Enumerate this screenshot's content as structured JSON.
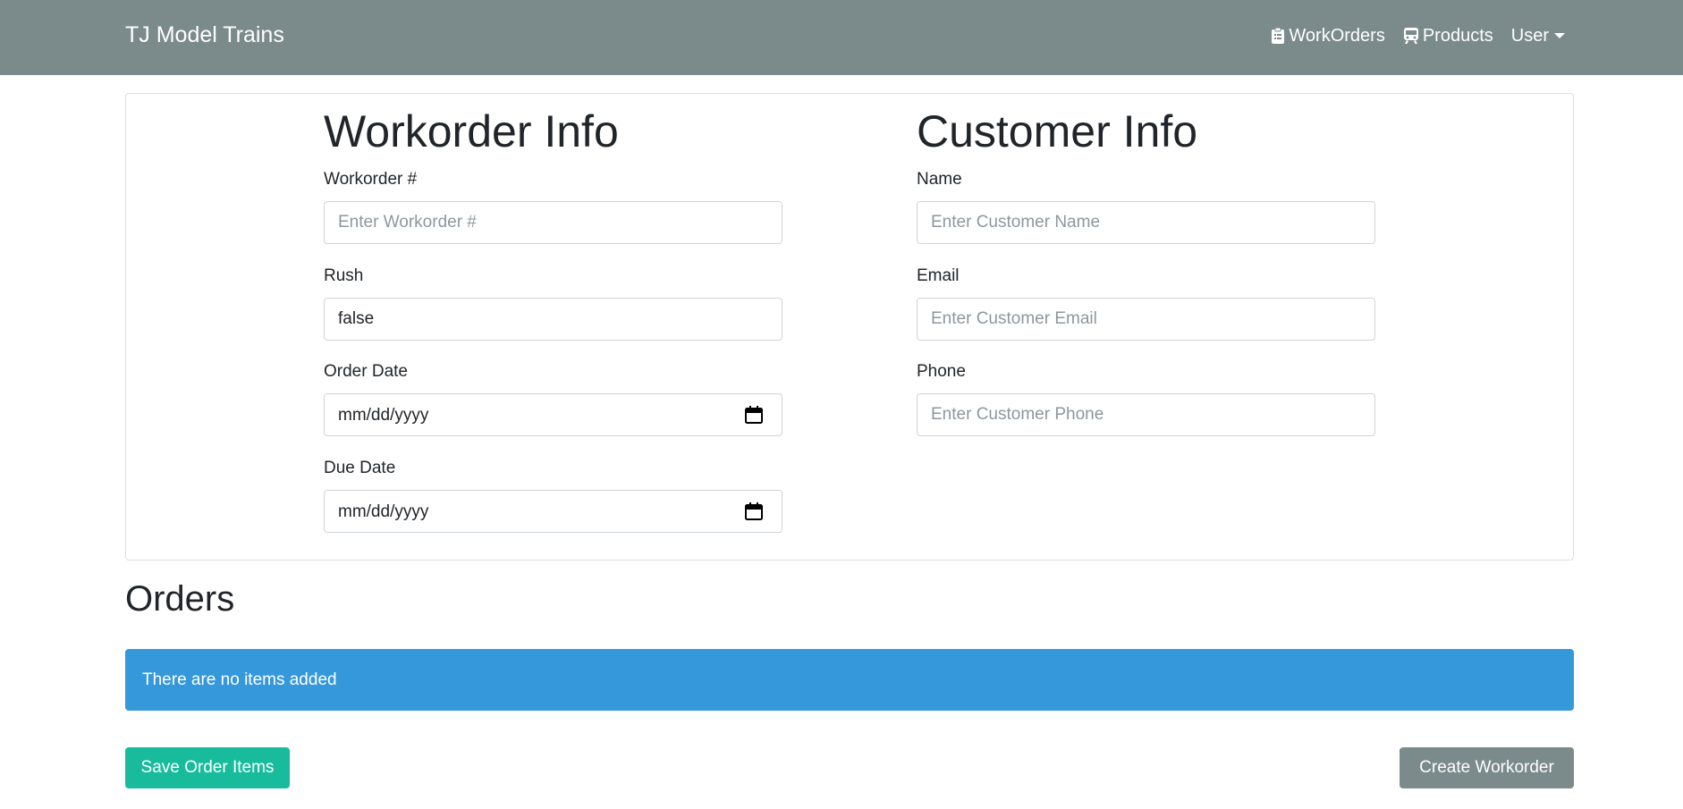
{
  "navbar": {
    "brand": "TJ Model Trains",
    "links": [
      {
        "label": "WorkOrders",
        "icon": "clipboard-icon"
      },
      {
        "label": "Products",
        "icon": "train-icon"
      },
      {
        "label": "User",
        "icon": "caret-down-icon"
      }
    ]
  },
  "workorder": {
    "title": "Workorder Info",
    "number": {
      "label": "Workorder #",
      "placeholder": "Enter Workorder #",
      "value": ""
    },
    "rush": {
      "label": "Rush",
      "value": "false"
    },
    "order_date": {
      "label": "Order Date",
      "value": "mm/dd/yyyy"
    },
    "due_date": {
      "label": "Due Date",
      "value": "mm/dd/yyyy"
    }
  },
  "customer": {
    "title": "Customer Info",
    "name": {
      "label": "Name",
      "placeholder": "Enter Customer Name",
      "value": ""
    },
    "email": {
      "label": "Email",
      "placeholder": "Enter Customer Email",
      "value": ""
    },
    "phone": {
      "label": "Phone",
      "placeholder": "Enter Customer Phone",
      "value": ""
    }
  },
  "orders": {
    "title": "Orders",
    "empty_message": "There are no items added"
  },
  "actions": {
    "save_label": "Save Order Items",
    "create_label": "Create Workorder"
  },
  "colors": {
    "navbar": "#7b8a8b",
    "info": "#3498db",
    "success": "#18bc9c",
    "secondary": "#7b8a8b"
  }
}
